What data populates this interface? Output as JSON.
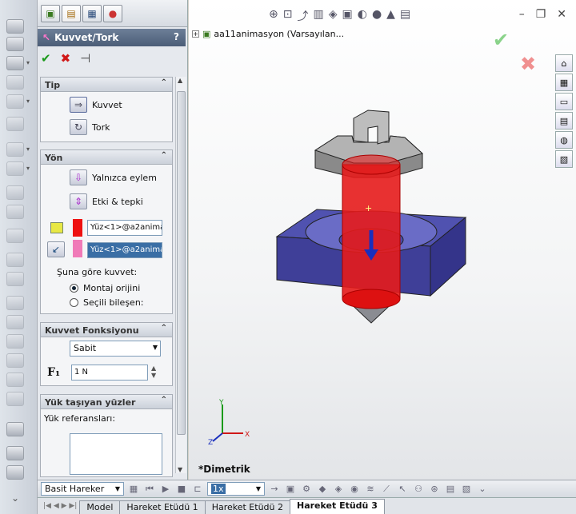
{
  "property_manager": {
    "title": "Kuvvet/Tork",
    "help": "?",
    "tip_group": {
      "header": "Tip",
      "options": [
        "Kuvvet",
        "Tork"
      ]
    },
    "yon_group": {
      "header": "Yön",
      "options": [
        "Yalnızca eylem",
        "Etki & tepki"
      ],
      "face1": "Yüz<1>@a2anima",
      "face2": "Yüz<1>@a2anima",
      "reference_label": "Şuna göre kuvvet:",
      "radio1": "Montaj orijini",
      "radio2": "Seçili bileşen:"
    },
    "function_group": {
      "header": "Kuvvet Fonksiyonu",
      "function_value": "Sabit",
      "f_label": "F₁",
      "force_value": "1 N"
    },
    "load_group": {
      "header": "Yük taşıyan yüzler",
      "references_label": "Yük referansları:"
    }
  },
  "graphics": {
    "tree_item": "aa11animasyon  (Varsayılan...",
    "view_name": "*Dimetrik",
    "axis_labels": {
      "x": "X",
      "y": "Y",
      "z": "Z"
    }
  },
  "bottom": {
    "study_type": "Basit Hareker",
    "speed": "1x",
    "tabs": [
      "Model",
      "Hareket Etüdü 1",
      "Hareket Etüdü 2",
      "Hareket Etüdü 3"
    ]
  },
  "colors": {
    "accent_header": "#4b5d77",
    "part_blue": "#4a4aa8",
    "force_red": "#dd1111"
  }
}
